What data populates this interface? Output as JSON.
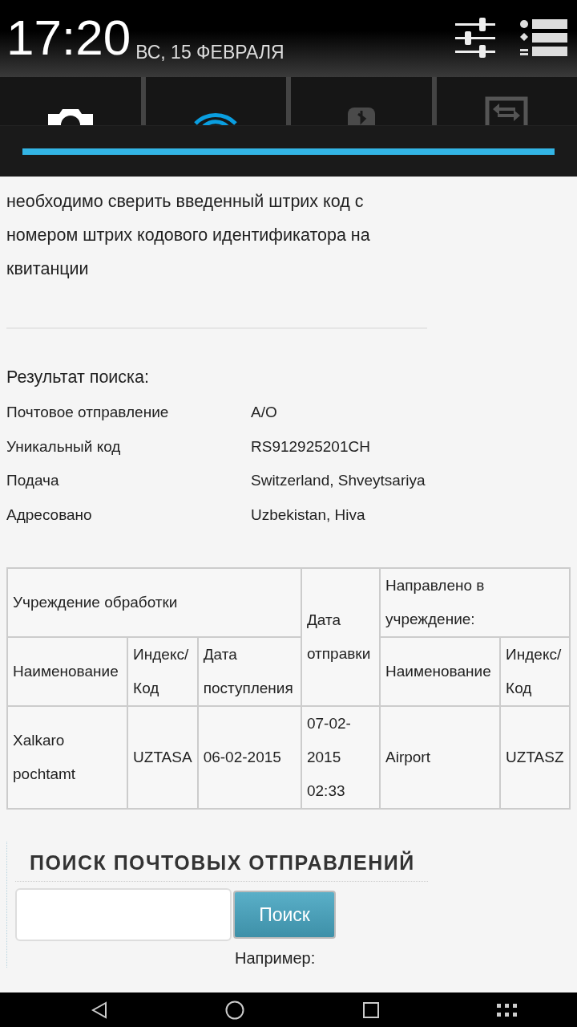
{
  "notification_shade": {
    "time": "17:20",
    "date": "ВС, 15 ФЕВРАЛЯ"
  },
  "article": {
    "paragraph": "необходимо сверить введенный штрих код с номером штрих кодового идентификатора на квитанции"
  },
  "result": {
    "title": "Результат поиска:",
    "fields": [
      {
        "label": "Почтовое отправление",
        "value": "A/O"
      },
      {
        "label": "Уникальный код",
        "value": "RS912925201CH"
      },
      {
        "label": "Подача",
        "value": "Switzerland, Shveytsariya"
      },
      {
        "label": "Адресовано",
        "value": "Uzbekistan, Hiva"
      }
    ]
  },
  "table": {
    "processing_office": {
      "title": "Учреждение обработки",
      "columns": [
        "Наименование",
        "Индекс/Код",
        "Дата поступления"
      ]
    },
    "dispatch_date": "Дата отправки",
    "forwarded_to": {
      "title": "Направлено в учреждение:",
      "columns": [
        "Наименование",
        "Индекс/Код"
      ]
    },
    "rows": [
      [
        "Xalkaro pochtamt",
        "UZTASA",
        "06-02-2015",
        "07-02-2015 02:33",
        "Airport",
        "UZTASZ"
      ]
    ]
  },
  "search": {
    "title": "ПОИСК ПОЧТОВЫХ ОТПРАВЛЕНИЙ",
    "button": "Поиск",
    "example_label": "Например:"
  }
}
